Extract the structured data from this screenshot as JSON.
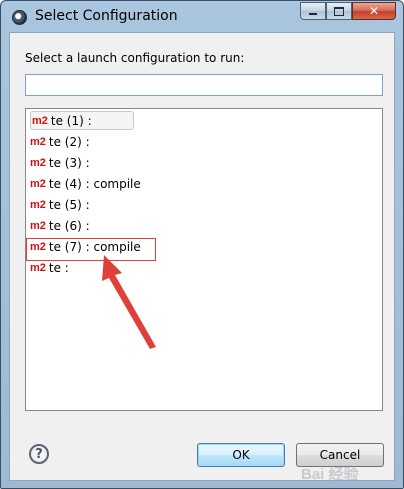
{
  "window": {
    "title": "Select Configuration",
    "controls": {
      "minimize_icon": "minimize-icon",
      "maximize_icon": "maximize-icon",
      "close_icon": "close-icon"
    }
  },
  "dialog": {
    "prompt": "Select a launch configuration to run:",
    "search": {
      "value": "",
      "placeholder": ""
    },
    "items": [
      {
        "badge": "m2",
        "label": "te (1) :"
      },
      {
        "badge": "m2",
        "label": "te (2) :"
      },
      {
        "badge": "m2",
        "label": "te (3) :"
      },
      {
        "badge": "m2",
        "label": "te (4) : compile"
      },
      {
        "badge": "m2",
        "label": "te (5) :"
      },
      {
        "badge": "m2",
        "label": "te (6) :"
      },
      {
        "badge": "m2",
        "label": "te (7) : compile"
      },
      {
        "badge": "m2",
        "label": "te :"
      }
    ],
    "help_glyph": "?",
    "ok_label": "OK",
    "cancel_label": "Cancel"
  },
  "annotation": {
    "color": "#e0403a",
    "highlighted_item": "te (7) : compile"
  },
  "watermark": "Bai 经验"
}
